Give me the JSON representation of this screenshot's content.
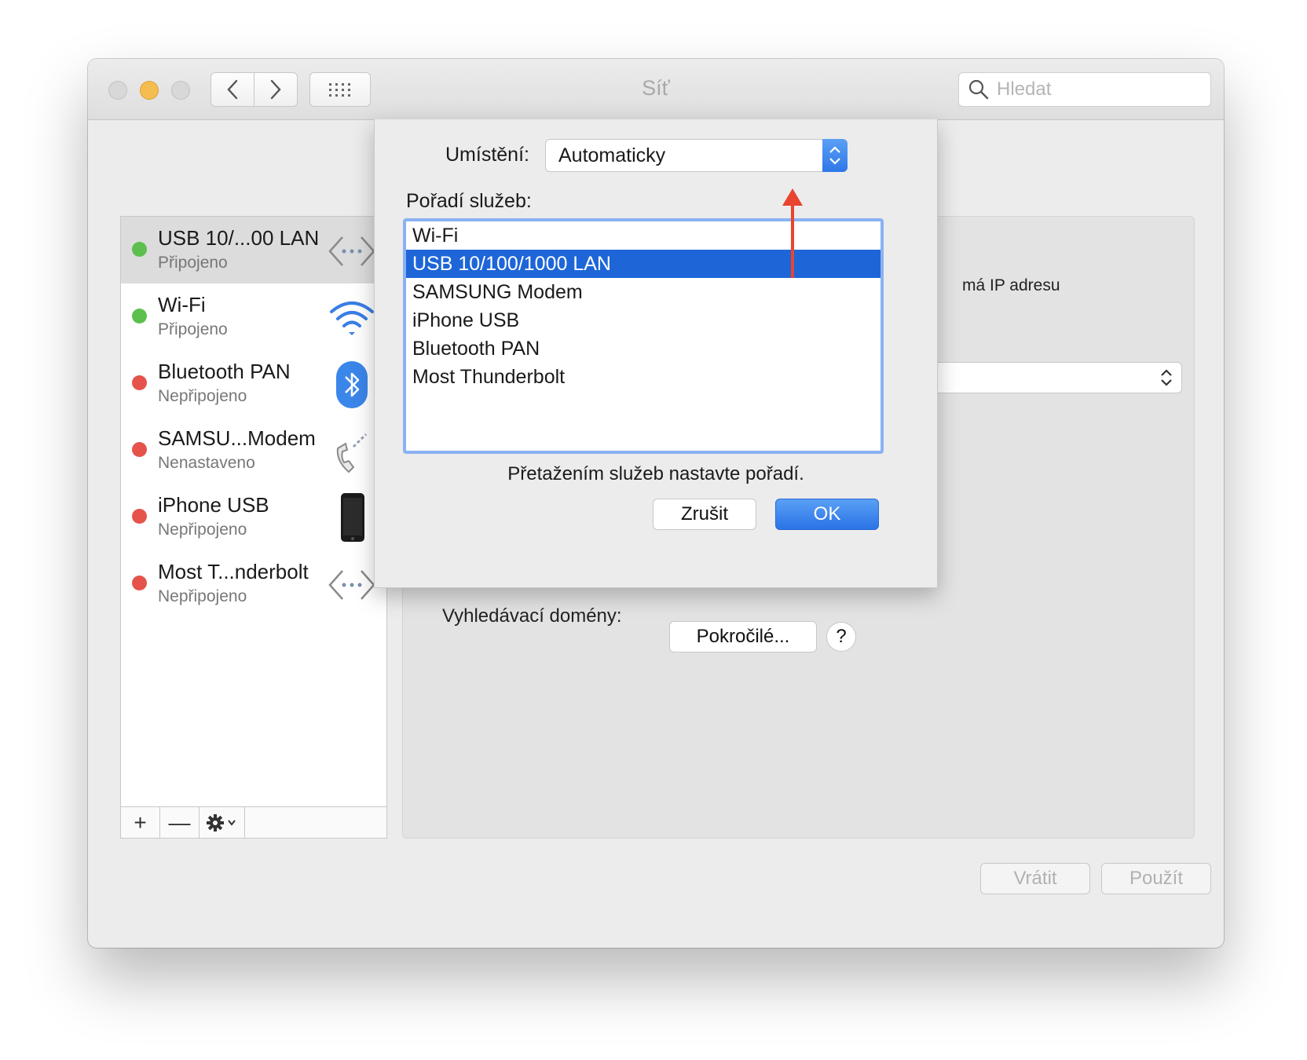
{
  "window": {
    "title": "Síť",
    "search_placeholder": "Hledat"
  },
  "sidebar": {
    "services": [
      {
        "name": "USB 10/...00 LAN",
        "status": "Připojeno",
        "status_color": "#5cbf4e",
        "icon": "ethernet-icon",
        "selected": true
      },
      {
        "name": "Wi-Fi",
        "status": "Připojeno",
        "status_color": "#5cbf4e",
        "icon": "wifi-icon"
      },
      {
        "name": "Bluetooth PAN",
        "status": "Nepřipojeno",
        "status_color": "#e5534b",
        "icon": "bluetooth-icon"
      },
      {
        "name": "SAMSU...Modem",
        "status": "Nenastaveno",
        "status_color": "#e5534b",
        "icon": "phone-icon"
      },
      {
        "name": "iPhone USB",
        "status": "Nepřipojeno",
        "status_color": "#e5534b",
        "icon": "iphone-icon"
      },
      {
        "name": "Most T...nderbolt",
        "status": "Nepřipojeno",
        "status_color": "#e5534b",
        "icon": "ethernet-icon"
      }
    ],
    "toolbar": {
      "add": "+",
      "remove": "—"
    }
  },
  "panel": {
    "ip_text_partial": "má IP adresu",
    "search_domains_label": "Vyhledávací domény:",
    "advanced_button": "Pokročilé...",
    "help_button": "?",
    "revert_button": "Vrátit",
    "apply_button": "Použít"
  },
  "sheet": {
    "location_label": "Umístění:",
    "location_value": "Automaticky",
    "service_order_label": "Pořadí služeb:",
    "service_order": [
      "Wi-Fi",
      "USB 10/100/1000 LAN",
      "SAMSUNG Modem",
      "iPhone USB",
      "Bluetooth PAN",
      "Most Thunderbolt"
    ],
    "selected_index": 1,
    "hint": "Přetažením služeb nastavte pořadí.",
    "cancel_button": "Zrušit",
    "ok_button": "OK"
  },
  "colors": {
    "accent": "#1e66d8",
    "annotation_arrow": "#e8442f"
  }
}
